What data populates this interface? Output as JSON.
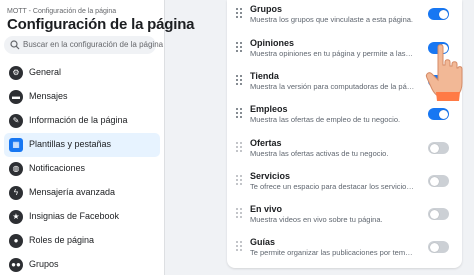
{
  "sidebar": {
    "breadcrumb": "MOTT - Configuración de la página",
    "title": "Configuración de la página",
    "search_placeholder": "Buscar en la configuración de la página",
    "items": [
      {
        "label": "General",
        "icon": "gear-icon"
      },
      {
        "label": "Mensajes",
        "icon": "messages-icon"
      },
      {
        "label": "Información de la página",
        "icon": "pencil-icon"
      },
      {
        "label": "Plantillas y pestañas",
        "icon": "templates-grid-icon",
        "active": true
      },
      {
        "label": "Notificaciones",
        "icon": "globe-icon"
      },
      {
        "label": "Mensajería avanzada",
        "icon": "messenger-icon"
      },
      {
        "label": "Insignias de Facebook",
        "icon": "badge-icon"
      },
      {
        "label": "Roles de página",
        "icon": "person-icon"
      },
      {
        "label": "Grupos",
        "icon": "group-icon"
      }
    ]
  },
  "tabs": [
    {
      "title": "Grupos",
      "desc": "Muestra los grupos que vinculaste a esta página.",
      "enabled": true
    },
    {
      "title": "Opiniones",
      "desc": "Muestra opiniones en tu página y permite a las per...",
      "enabled": true
    },
    {
      "title": "Tienda",
      "desc": "Muestra la versión para computadoras de la página.",
      "enabled": true
    },
    {
      "title": "Empleos",
      "desc": "Muestra las ofertas de empleo de tu negocio.",
      "enabled": true
    },
    {
      "title": "Ofertas",
      "desc": "Muestra las ofertas activas de tu negocio.",
      "enabled": false
    },
    {
      "title": "Servicios",
      "desc": "Te ofrece un espacio para destacar los servicios q...",
      "enabled": false
    },
    {
      "title": "En vivo",
      "desc": "Muestra videos en vivo sobre tu página.",
      "enabled": false
    },
    {
      "title": "Guías",
      "desc": "Te permite organizar las publicaciones por tema pa...",
      "enabled": false
    }
  ],
  "colors": {
    "accent": "#1877f2",
    "toggle_off": "#ccd0d5",
    "active_bg": "#e7f3ff"
  }
}
